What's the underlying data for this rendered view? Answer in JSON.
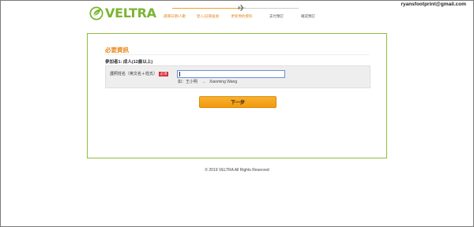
{
  "header": {
    "user_email": "ryansfootprint@gmail.com",
    "brand": "VELTRA",
    "steps": [
      {
        "label": "選擇日期/人數",
        "state": "done"
      },
      {
        "label": "登入/註冊會員",
        "state": "done"
      },
      {
        "label": "更新預約資料",
        "state": "current"
      },
      {
        "label": "支付預訂",
        "state": "todo"
      },
      {
        "label": "確認預訂",
        "state": "todo"
      }
    ],
    "icons": {
      "logo": "veltra-leaf-logo-icon",
      "progress": "airplane-icon"
    },
    "colors": {
      "brand_green": "#7ab532",
      "accent_orange": "#e8881a",
      "required_red": "#d9232d"
    }
  },
  "form": {
    "title": "必要資訊",
    "participant_label": "參加者1: 成人(12歲以上)",
    "field_label": "護照姓名（英文名＋姓氏）",
    "required_badge": "必須",
    "input_value": "",
    "example_text": "如：王小明　→　Xiaoming Wang",
    "next_button": "下一步"
  },
  "footer": {
    "copyright": "© 2019 VELTRA All Rights Reserved"
  }
}
